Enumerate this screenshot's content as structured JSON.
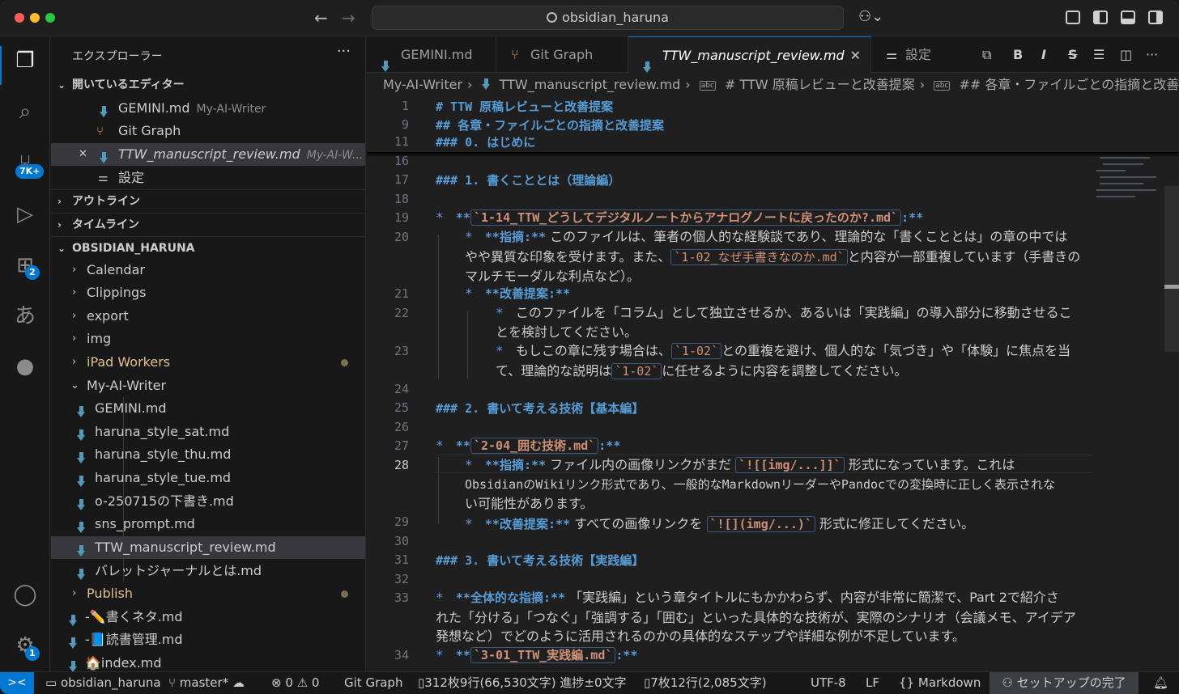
{
  "titlebar": {
    "search_text": "obsidian_haruna",
    "back": "←",
    "forward": "→"
  },
  "activity": {
    "items": [
      {
        "name": "explorer",
        "glyph": "❐"
      },
      {
        "name": "search",
        "glyph": "⌕"
      },
      {
        "name": "source-control",
        "glyph": "⑂",
        "badge": "7K+"
      },
      {
        "name": "run-debug",
        "glyph": "▷"
      },
      {
        "name": "extensions",
        "glyph": "⊞",
        "badge": "2"
      },
      {
        "name": "japanese-input",
        "glyph": "あ"
      },
      {
        "name": "github",
        "glyph": "●"
      }
    ],
    "accounts_glyph": "◯",
    "manage_glyph": "⚙",
    "manage_badge": "1"
  },
  "sidebar": {
    "title": "エクスプローラー",
    "more": "···",
    "open_editors_label": "開いているエディター",
    "open_editors": [
      {
        "label": "GEMINI.md",
        "sub": "My-AI-Writer"
      },
      {
        "label": "Git Graph",
        "sub": ""
      },
      {
        "label": "TTW_manuscript_review.md",
        "sub": "My-AI-W..."
      },
      {
        "label": "設定",
        "sub": ""
      }
    ],
    "outline_label": "アウトライン",
    "timeline_label": "タイムライン",
    "workspace_label": "OBSIDIAN_HARUNA",
    "tree": [
      {
        "label": "Calendar"
      },
      {
        "label": "Clippings"
      },
      {
        "label": "export"
      },
      {
        "label": "img"
      },
      {
        "label": "iPad Workers"
      },
      {
        "label": "My-AI-Writer"
      },
      {
        "label": "GEMINI.md"
      },
      {
        "label": "haruna_style_sat.md"
      },
      {
        "label": "haruna_style_thu.md"
      },
      {
        "label": "haruna_style_tue.md"
      },
      {
        "label": "o-250715の下書き.md"
      },
      {
        "label": "sns_prompt.md"
      },
      {
        "label": "TTW_manuscript_review.md"
      },
      {
        "label": "バレットジャーナルとは.md"
      },
      {
        "label": "Publish"
      },
      {
        "label": "-✏️書くネタ.md"
      },
      {
        "label": "-📘読書管理.md"
      },
      {
        "label": "🏠index.md"
      }
    ]
  },
  "tabs": [
    {
      "label": "GEMINI.md"
    },
    {
      "label": "Git Graph"
    },
    {
      "label": "TTW_manuscript_review.md"
    },
    {
      "label": "設定"
    }
  ],
  "toolbar": {
    "bold": "B",
    "italic": "I",
    "strike": "S",
    "list": "☰",
    "split": "◫",
    "more": "···"
  },
  "breadcrumbs": [
    "My-AI-Writer",
    "TTW_manuscript_review.md",
    "# TTW 原稿レビューと改善提案",
    "## 各章・ファイルごとの指摘と改善"
  ],
  "editor": {
    "sticky": [
      {
        "n": "1",
        "text": "# TTW 原稿レビューと改善提案"
      },
      {
        "n": "9",
        "text": "## 各章・ファイルごとの指摘と改善提案"
      },
      {
        "n": "11",
        "text": "### 0. はじめに"
      }
    ],
    "ln": {
      "l16": "16",
      "l17": "17",
      "l18": "18",
      "l19": "19",
      "l20": "20",
      "l21": "21",
      "l22": "22",
      "l23": "23",
      "l24": "24",
      "l25": "25",
      "l26": "26",
      "l27": "27",
      "l28": "28",
      "l29": "29",
      "l30": "30",
      "l31": "31",
      "l32": "32",
      "l33": "33",
      "l34": "34"
    },
    "l17": "### 1. 書くこととは（理論編）",
    "l19_code": "`1-14_TTW_どうしてデジタルノートからアナログノートに戻ったのか?.md`",
    "l20_a": "このファイルは、筆者の個人的な経験談であり、理論的な「書くこととは」の章の中では",
    "l20_b": "やや異質な印象を受けます。また、",
    "l20_code": "`1-02_なぜ手書きなのか.md`",
    "l20_c": "と内容が一部重複しています（手書きの",
    "l20_d": "マルチモーダルな利点など）。",
    "l22_a": "このファイルを「コラム」として独立させるか、あるいは「実践編」の導入部分に移動させるこ",
    "l22_b": "とを検討してください。",
    "l23_a": "もしこの章に残す場合は、",
    "l23_code": "`1-02`",
    "l23_b": "との重複を避け、個人的な「気づき」や「体験」に焦点を当",
    "l23_c": "て、理論的な説明は",
    "l23_d": "に任せるように内容を調整してください。",
    "l25": "### 2. 書いて考える技術【基本編】",
    "l27_code": "`2-04_囲む技術.md`",
    "l28_a": "ファイル内の画像リンクがまだ",
    "l28_code": "`![[img/...]]`",
    "l28_b": "形式になっています。これは",
    "l28_c": "ObsidianのWikiリンク形式であり、一般的なMarkdownリーダーやPandocでの変換時に正しく表示されな",
    "l28_d": "い可能性があります。",
    "l29_a": "すべての画像リンクを",
    "l29_code": "`![](img/...)`",
    "l29_b": "形式に修正してください。",
    "l31": "### 3. 書いて考える技術【実践編】",
    "l33_a": "「実践編」という章タイトルにもかかわらず、内容が非常に簡潔で、Part 2で紹介さ",
    "l33_b": "れた「分ける」「つなぐ」「強調する」「囲む」といった具体的な技術が、実際のシナリオ（会議メモ、アイデア",
    "l33_c": "発想など）でどのように活用されるのかの具体的なステップや詳細な例が不足しています。",
    "l34_code": "`3-01_TTW_実践編.md`",
    "bullet": "*",
    "bold_open": "**",
    "bold_close": ":**",
    "shiteki": "**指摘:**",
    "kaizen": "**改善提案:**",
    "zentai": "**全体的な指摘:**"
  },
  "status": {
    "remote": "><",
    "workspace": "obsidian_haruna",
    "branch": "master*",
    "errors": "0",
    "warnings": "0",
    "gitgraph": "Git Graph",
    "wordcount": "312枚9行(66,530文字) 進捗±0文字",
    "pagecount": "7枚12行(2,085文字)",
    "encoding": "UTF-8",
    "eol": "LF",
    "language": "Markdown",
    "setup": "セットアップの完了"
  }
}
